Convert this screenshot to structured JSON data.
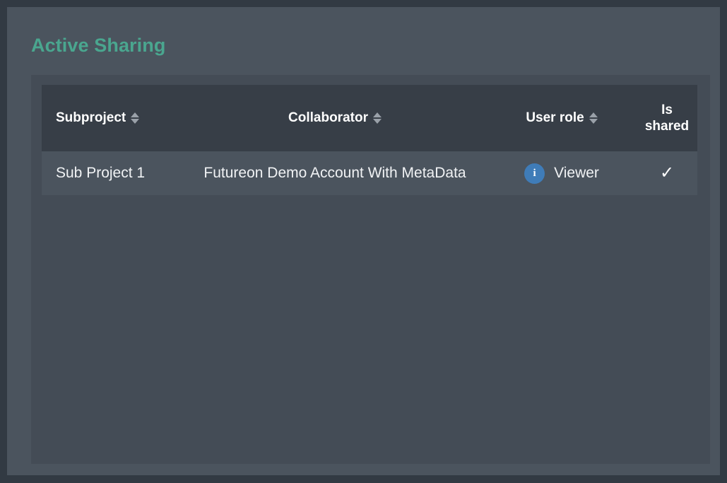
{
  "page": {
    "section_title": "Active Sharing"
  },
  "table": {
    "columns": [
      {
        "label": "Subproject",
        "sortable": true,
        "sort_icon": "sort-updown-icon"
      },
      {
        "label": "Collaborator",
        "sortable": true,
        "sort_icon": "sort-updown-icon"
      },
      {
        "label": "User role",
        "sortable": true,
        "sort_icon": "sort-updown-icon"
      },
      {
        "label": "Is shared",
        "sortable": false,
        "sort_icon": ""
      }
    ],
    "rows": [
      {
        "subproject": "Sub Project 1",
        "collaborator": "Futureon Demo Account With MetaData",
        "user_role": "Viewer",
        "role_badge_icon": "info-icon",
        "role_badge_glyph": "i",
        "is_shared": "✓"
      }
    ]
  },
  "colors": {
    "page_background": "#323a43",
    "panel_background": "#4b545e",
    "card_background": "#444c56",
    "header_row_background": "#373e47",
    "data_row_background": "#4b545e",
    "title_accent": "#4aa68f",
    "badge_blue": "#3f7cb8",
    "sort_icon_gray": "#9aa1a9",
    "text_primary": "#f0f2f4"
  }
}
